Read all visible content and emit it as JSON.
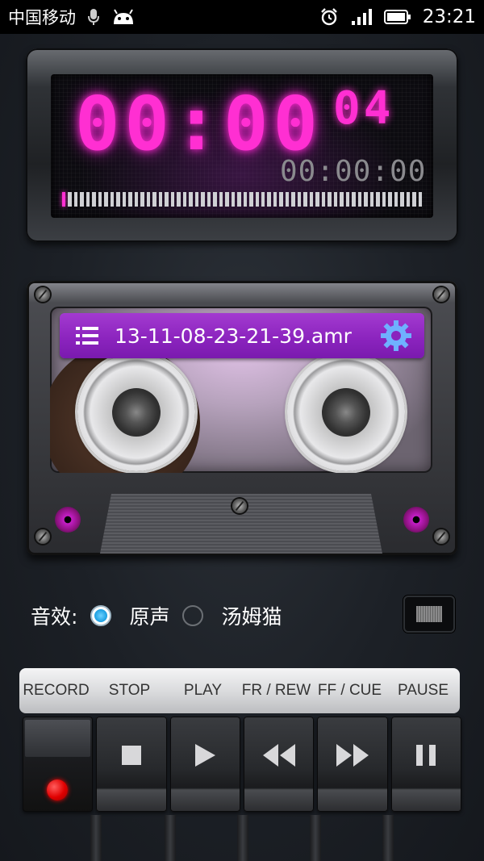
{
  "status": {
    "carrier": "中国移动",
    "time": "23:21",
    "icons": [
      "mic-icon",
      "android-icon",
      "alarm-icon",
      "signal-icon",
      "battery-icon"
    ]
  },
  "timer": {
    "main": "00:00",
    "seconds": "04",
    "total": "00:00:00"
  },
  "file": {
    "name": "13-11-08-23-21-39.amr"
  },
  "effects": {
    "label": "音效:",
    "options": [
      {
        "label": "原声",
        "selected": true
      },
      {
        "label": "汤姆猫",
        "selected": false
      }
    ]
  },
  "controls": {
    "labels": [
      "RECORD",
      "STOP",
      "PLAY",
      "FR / REW",
      "FF / CUE",
      "PAUSE"
    ]
  },
  "colors": {
    "led": "#ff2fd2",
    "file_bar": "#8a23bd",
    "radio_on": "#1a9ee0",
    "record": "#e00000"
  }
}
